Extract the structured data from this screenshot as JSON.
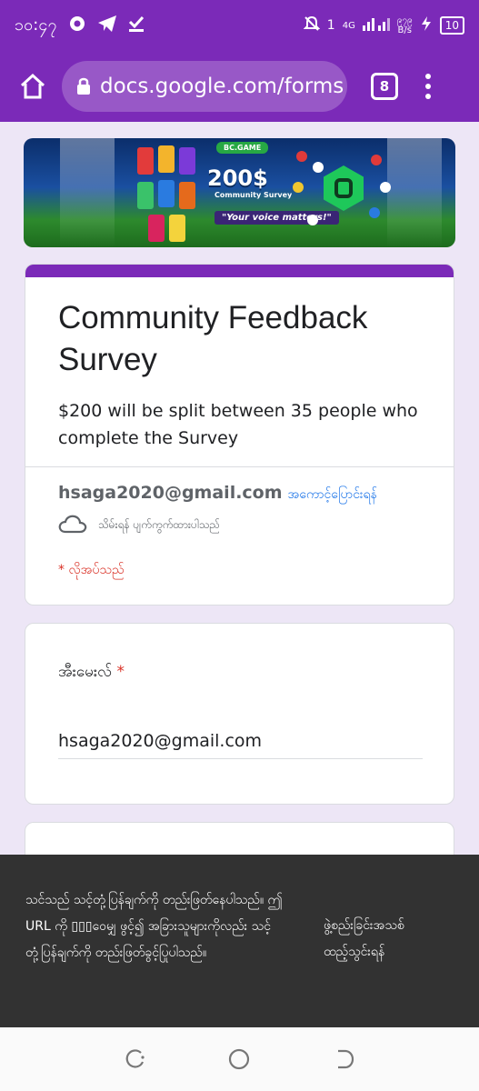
{
  "status_bar": {
    "time": "၁၀:၄၇",
    "network": "4G",
    "net_speed_top": "၉၇၉",
    "net_speed_unit": "B/s",
    "battery": "10"
  },
  "browser": {
    "url": "docs.google.com/forms",
    "tab_count": "8"
  },
  "banner": {
    "brand": "BC.GAME",
    "amount": "200$",
    "subtitle": "Community Survey",
    "tagline": "\"Your voice matters!\""
  },
  "form": {
    "title": "Community Feedback Survey",
    "description": "$200 will be split between 35 people who complete the Survey",
    "account_email": "hsaga2020@gmail.com",
    "switch_account": "အကောင့်ပြောင်းရန်",
    "not_saved": "သိမ်းရန် ပျက်ကွက်ထားပါသည်",
    "required_note": "* လိုအပ်သည်"
  },
  "question_email": {
    "label": "အီးမေးလ်",
    "required_mark": "*",
    "value": "hsaga2020@gmail.com"
  },
  "snackbar": {
    "message": "သင်သည် သင့်တုံ့ပြန်ချက်ကို တည်းဖြတ်နေပါသည်။ ဤ URL ကို ▯▯▯ဝေမျှ ဖွင့်၍ အခြားသူများကိုလည်း သင့်တုံ့ပြန်ချက်ကို တည်းဖြတ်ခွင့်ပြုပါသည်။",
    "action": "ဖွဲ့စည်းခြင်းအသစ် ထည့်သွင်းရန်"
  },
  "colors": {
    "accent": "#7b2ab8",
    "background": "#ede6f6",
    "required": "#d93025",
    "link": "#1a73e8"
  }
}
